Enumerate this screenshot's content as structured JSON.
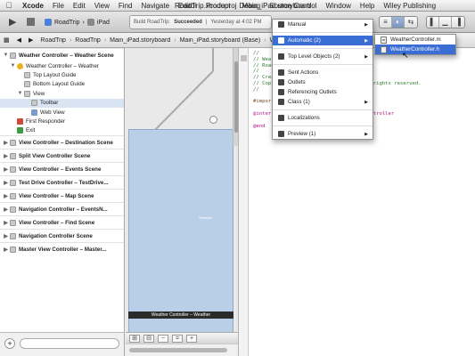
{
  "menubar": {
    "apple": "",
    "items": [
      "Xcode",
      "File",
      "Edit",
      "View",
      "Find",
      "Navigate",
      "Editor",
      "Product",
      "Debug",
      "Source Control",
      "Window",
      "Help",
      "Wiley Publishing"
    ]
  },
  "toolbar": {
    "scheme": "RoadTrip",
    "destination": "iPad",
    "status_prefix": "Build RoadTrip:",
    "status_state": "Succeeded",
    "status_time": "Yesterday at 4:02 PM",
    "doc_title": "RoadTrip.xcodeproj",
    "doc_title_2": "Main_iPad.storyboard"
  },
  "jumpbar": {
    "items": [
      "RoadTrip",
      "RoadTrip",
      "Main_iPad.storyboard",
      "Main_iPad.storyboard (Base)",
      "Weather Controller Scene",
      "Weather Controller",
      "View",
      "Toolbar"
    ]
  },
  "outline": {
    "rows": [
      {
        "label": "Weather Controller – Weather Scene",
        "level": 0,
        "kind": "scene",
        "tri": "▼",
        "icon": "grey"
      },
      {
        "label": "Weather Controller – Weather",
        "level": 1,
        "kind": "item",
        "tri": "▼",
        "icon": "yellow"
      },
      {
        "label": "Top Layout Guide",
        "level": 2,
        "kind": "item",
        "tri": "",
        "icon": "grey"
      },
      {
        "label": "Bottom Layout Guide",
        "level": 2,
        "kind": "item",
        "tri": "",
        "icon": "grey"
      },
      {
        "label": "View",
        "level": 2,
        "kind": "item",
        "tri": "▼",
        "icon": "grey"
      },
      {
        "label": "Toolbar",
        "level": 3,
        "kind": "sel",
        "tri": "",
        "icon": "grey"
      },
      {
        "label": "Web View",
        "level": 3,
        "kind": "item",
        "tri": "",
        "icon": "blue"
      },
      {
        "label": "First Responder",
        "level": 1,
        "kind": "item",
        "tri": "",
        "icon": "red"
      },
      {
        "label": "Exit",
        "level": 1,
        "kind": "item",
        "tri": "",
        "icon": "green"
      },
      {
        "label": "View Controller – Destination Scene",
        "level": 0,
        "kind": "scene",
        "tri": "▶",
        "icon": "grey"
      },
      {
        "label": "Split View Controller Scene",
        "level": 0,
        "kind": "scene",
        "tri": "▶",
        "icon": "grey"
      },
      {
        "label": "View Controller – Events Scene",
        "level": 0,
        "kind": "scene",
        "tri": "▶",
        "icon": "grey"
      },
      {
        "label": "Test Drive Controller – TestDrive...",
        "level": 0,
        "kind": "scene",
        "tri": "▶",
        "icon": "grey"
      },
      {
        "label": "View Controller – Map Scene",
        "level": 0,
        "kind": "scene",
        "tri": "▶",
        "icon": "grey"
      },
      {
        "label": "Navigation Controller – EventsN...",
        "level": 0,
        "kind": "scene",
        "tri": "▶",
        "icon": "grey"
      },
      {
        "label": "View Controller – Find Scene",
        "level": 0,
        "kind": "scene",
        "tri": "▶",
        "icon": "grey"
      },
      {
        "label": "Navigation Controller Scene",
        "level": 0,
        "kind": "scene",
        "tri": "▶",
        "icon": "grey"
      },
      {
        "label": "Master View Controller – Master...",
        "level": 0,
        "kind": "scene",
        "tri": "▶",
        "icon": "grey"
      }
    ]
  },
  "canvas": {
    "doc_label": "Weather Controller – Weather",
    "view_label": "Weather"
  },
  "code": {
    "lines": [
      {
        "text": "//",
        "cls": "c-comment"
      },
      {
        "text": "//  WeatherController.h",
        "cls": "c-comment"
      },
      {
        "text": "//  RoadTrip",
        "cls": "c-comment"
      },
      {
        "text": "//",
        "cls": "c-comment"
      },
      {
        "text": "//  Created by Jesse Feiler on 8/10/13.",
        "cls": "c-comment"
      },
      {
        "text": "//  Copyright (c) 2013 Jesse Feiler. All rights reserved.",
        "cls": "c-comment"
      },
      {
        "text": "//",
        "cls": "c-comment"
      },
      {
        "text": "",
        "cls": ""
      },
      {
        "text": "#import <UIKit/UIKit.h>",
        "cls": "c-pre"
      },
      {
        "text": "",
        "cls": ""
      },
      {
        "text": "@interface WeatherController : UIViewController",
        "cls": "c-kw"
      },
      {
        "text": "",
        "cls": ""
      },
      {
        "text": "@end",
        "cls": "c-kw"
      }
    ]
  },
  "menu": {
    "items": [
      {
        "label": "Manual",
        "arrow": "▶",
        "hl": false
      },
      {
        "sep": true
      },
      {
        "label": "Automatic (2)",
        "arrow": "▶",
        "hl": true
      },
      {
        "sep": true
      },
      {
        "label": "Top Level Objects (2)",
        "arrow": "▶",
        "hl": false
      },
      {
        "sep": true
      },
      {
        "label": "Sent Actions",
        "arrow": "",
        "hl": false
      },
      {
        "label": "Outlets",
        "arrow": "",
        "hl": false
      },
      {
        "label": "Referencing Outlets",
        "arrow": "",
        "hl": false
      },
      {
        "label": "Class (1)",
        "arrow": "▶",
        "hl": false
      },
      {
        "sep": true
      },
      {
        "label": "Localizations",
        "arrow": "",
        "hl": false
      },
      {
        "sep": true
      },
      {
        "label": "Preview (1)",
        "arrow": "▶",
        "hl": false
      }
    ]
  },
  "submenu": {
    "items": [
      {
        "label": "WeatherController.m",
        "hl": false,
        "ext": "m"
      },
      {
        "label": "WeatherController.h",
        "hl": true,
        "ext": "h"
      }
    ]
  }
}
